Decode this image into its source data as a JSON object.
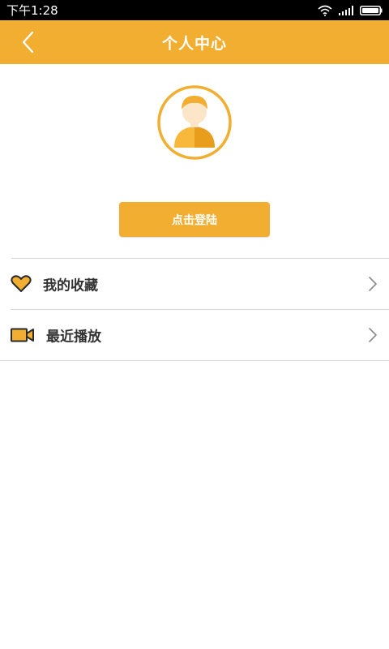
{
  "status_bar": {
    "time": "下午1:28",
    "icons": [
      "wifi-icon",
      "signal-icon",
      "battery-icon"
    ]
  },
  "header": {
    "title": "个人中心",
    "back_icon": "chevron-left-icon"
  },
  "profile": {
    "avatar_icon": "user-avatar-icon",
    "login_label": "点击登陆"
  },
  "menu": {
    "items": [
      {
        "label": "我的收藏",
        "icon": "heart-icon",
        "trailing_icon": "chevron-right-icon"
      },
      {
        "label": "最近播放",
        "icon": "video-camera-icon",
        "trailing_icon": "chevron-right-icon"
      }
    ]
  },
  "colors": {
    "accent": "#f2ae30",
    "status_bar": "#000000",
    "text": "#333333",
    "divider": "#d8d8d8"
  }
}
